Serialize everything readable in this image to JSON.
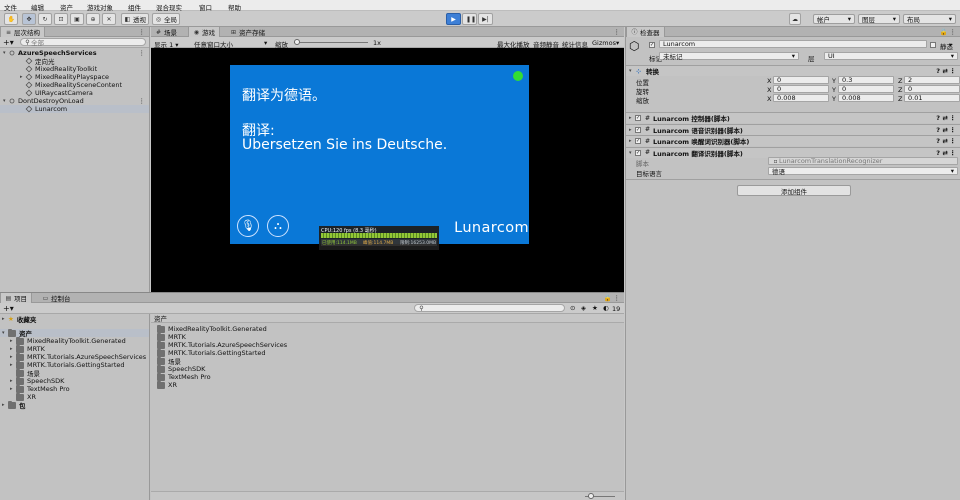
{
  "menu": [
    "文件",
    "编辑",
    "资产",
    "游戏对象",
    "组件",
    "混合现实",
    "窗口",
    "帮助"
  ],
  "toolbar": {
    "transparent_label": "透视",
    "global_label": "全局",
    "account": "帐户",
    "layers": "图层",
    "layout": "布局"
  },
  "hierarchy": {
    "tab": "层次结构",
    "search_placeholder": "全部",
    "items": [
      {
        "label": "AzureSpeechServices",
        "depth": 0,
        "kind": "scene",
        "bold": true
      },
      {
        "label": "定向光",
        "depth": 1,
        "kind": "go"
      },
      {
        "label": "MixedRealityToolkit",
        "depth": 1,
        "kind": "go"
      },
      {
        "label": "MixedRealityPlayspace",
        "depth": 1,
        "kind": "go"
      },
      {
        "label": "MixedRealitySceneContent",
        "depth": 1,
        "kind": "go"
      },
      {
        "label": "UIRaycastCamera",
        "depth": 1,
        "kind": "go"
      },
      {
        "label": "DontDestroyOnLoad",
        "depth": 0,
        "kind": "scene"
      },
      {
        "label": "Lunarcom",
        "depth": 1,
        "kind": "go",
        "selected": true
      }
    ]
  },
  "game": {
    "tab_scene": "场景",
    "tab_game": "游戏",
    "tab_store": "资产存储",
    "display": "显示 1",
    "aspect": "任意窗口大小",
    "scale_label": "缩放",
    "scale_value": "1x",
    "max_on_play": "最大化播放",
    "mute": "音频静音",
    "stats": "统计信息",
    "gizmos": "Gizmos",
    "line1": "翻译为德语。",
    "line2": "翻译:",
    "line3": "Übersetzen Sie ins Deutsche.",
    "brand": "Lunarcom",
    "stats_overlay": {
      "cpu": "CPU:120 fps (8.3 毫秒)",
      "used": "已使用:114.1MB",
      "peak": "峰值:114.7MB",
      "limit": "限制:16253.0MB"
    },
    "colors": {
      "panel": "#0a78d7",
      "dot": "#33dd33"
    }
  },
  "project": {
    "tab_project": "项目",
    "tab_console": "控制台",
    "favorites": "收藏夹",
    "assets_root": "资产",
    "tree": [
      "MixedRealityToolkit.Generated",
      "MRTK",
      "MRTK.Tutorials.AzureSpeechServices",
      "MRTK.Tutorials.GettingStarted",
      "场景",
      "SpeechSDK",
      "TextMesh Pro",
      "XR"
    ],
    "packages": "包",
    "breadcrumb": "资产",
    "list": [
      "MixedRealityToolkit.Generated",
      "MRTK",
      "MRTK.Tutorials.AzureSpeechServices",
      "MRTK.Tutorials.GettingStarted",
      "场景",
      "SpeechSDK",
      "TextMesh Pro",
      "XR"
    ],
    "count": "19"
  },
  "inspector": {
    "tab": "检查器",
    "name": "Lunarcom",
    "static_label": "静态",
    "tag_label": "标记",
    "tag_value": "未标记",
    "layer_label": "层",
    "layer_value": "UI",
    "transform_title": "转换",
    "position_label": "位置",
    "rotation_label": "旋转",
    "scale_label": "缩放",
    "position": {
      "x": "0",
      "y": "0.3",
      "z": "2"
    },
    "rotation": {
      "x": "0",
      "y": "0",
      "z": "0"
    },
    "scale": {
      "x": "0.008",
      "y": "0.008",
      "z": "0.01"
    },
    "components": [
      "Lunarcom 控制器(脚本)",
      "Lunarcom 语音识别器(脚本)",
      "Lunarcom 唤醒词识别器(脚本)",
      "Lunarcom 翻译识别器(脚本)"
    ],
    "script_label": "脚本",
    "script_value": "LunarcomTranslationRecognizer",
    "target_lang_label": "目标语言",
    "target_lang_value": "德语",
    "add_component": "添加组件"
  }
}
